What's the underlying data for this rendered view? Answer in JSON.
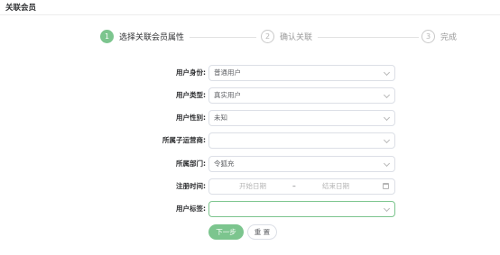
{
  "page": {
    "title": "关联会员"
  },
  "steps": [
    {
      "number": "1",
      "label": "选择关联会员属性",
      "state": "active"
    },
    {
      "number": "2",
      "label": "确认关联",
      "state": "pending"
    },
    {
      "number": "3",
      "label": "完成",
      "state": "pending"
    }
  ],
  "form": {
    "user_identity": {
      "label": "用户身份:",
      "value": "普通用户"
    },
    "user_type": {
      "label": "用户类型:",
      "value": "真实用户"
    },
    "user_gender": {
      "label": "用户性别:",
      "value": "未知"
    },
    "sub_operator": {
      "label": "所属子运营商:",
      "value": ""
    },
    "department": {
      "label": "所属部门:",
      "value": "令狐充"
    },
    "register_time": {
      "label": "注册时间:",
      "start_placeholder": "开始日期",
      "separator": "–",
      "end_placeholder": "结束日期"
    },
    "user_tags": {
      "label": "用户标签:",
      "value": ""
    }
  },
  "buttons": {
    "next": "下一步",
    "reset": "重 置"
  },
  "colors": {
    "accent": "#7cc58e",
    "border": "#dcdfe6"
  }
}
